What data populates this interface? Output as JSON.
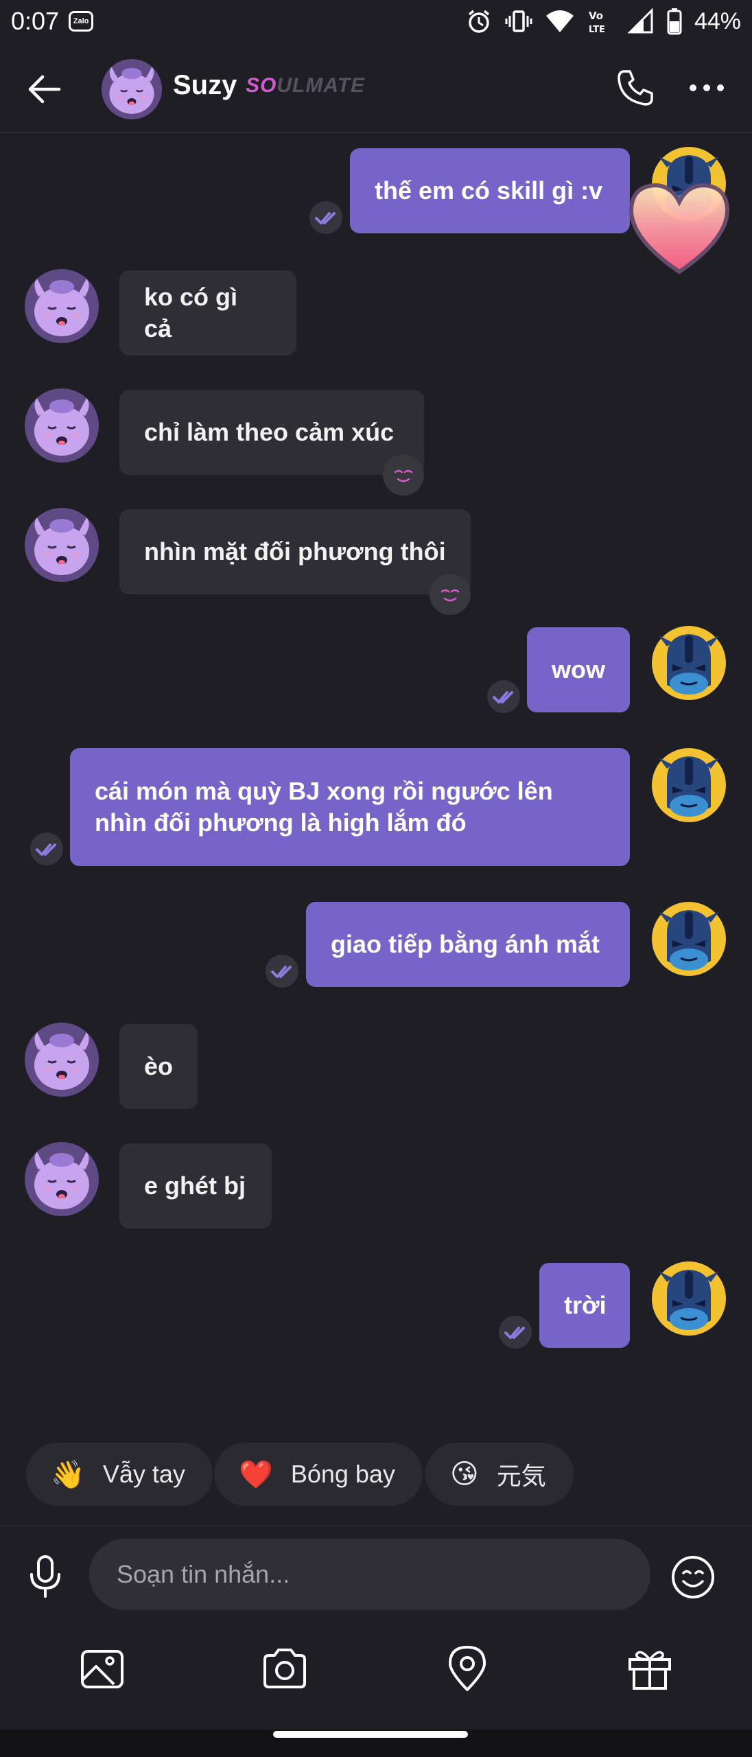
{
  "status_bar": {
    "time": "0:07",
    "app_badge": "Zalo",
    "network": "Vo LTE",
    "battery": "44%"
  },
  "header": {
    "name": "Suzy",
    "badge": "SOULMATE",
    "badge_highlight": "SO",
    "badge_rest": "ULMATE"
  },
  "messages": [
    {
      "side": "out",
      "text": "thế em có skill gì :v"
    },
    {
      "side": "in",
      "text": "ko có gì cả"
    },
    {
      "side": "in",
      "text": "chỉ làm theo cảm xúc",
      "reaction": "blush-emoji"
    },
    {
      "side": "in",
      "text": "nhìn mặt đối phương thôi",
      "reaction": "blush-emoji"
    },
    {
      "side": "out",
      "text": "wow"
    },
    {
      "side": "out",
      "text": "cái món mà quỳ BJ xong rồi ngước lên nhìn đối phương là high lắm đó"
    },
    {
      "side": "out",
      "text": "giao tiếp bằng ánh mắt"
    },
    {
      "side": "in",
      "text": "èo"
    },
    {
      "side": "in",
      "text": "e ghét bj"
    },
    {
      "side": "out",
      "text": "trời"
    }
  ],
  "quick_reactions": [
    {
      "icon": "👋",
      "label": "Vẫy tay"
    },
    {
      "icon": "❤️",
      "label": "Bóng bay"
    },
    {
      "icon": "😘",
      "label": "元気"
    }
  ],
  "composer": {
    "placeholder": "Soạn tin nhắn..."
  },
  "toolbar_icons": [
    "image-icon",
    "camera-icon",
    "location-icon",
    "gift-icon"
  ],
  "colors": {
    "background": "#1f1e24",
    "incoming_bubble": "#2f2e35",
    "outgoing_bubble": "#7764c9",
    "soulmate_accent": "#d35ad2"
  }
}
